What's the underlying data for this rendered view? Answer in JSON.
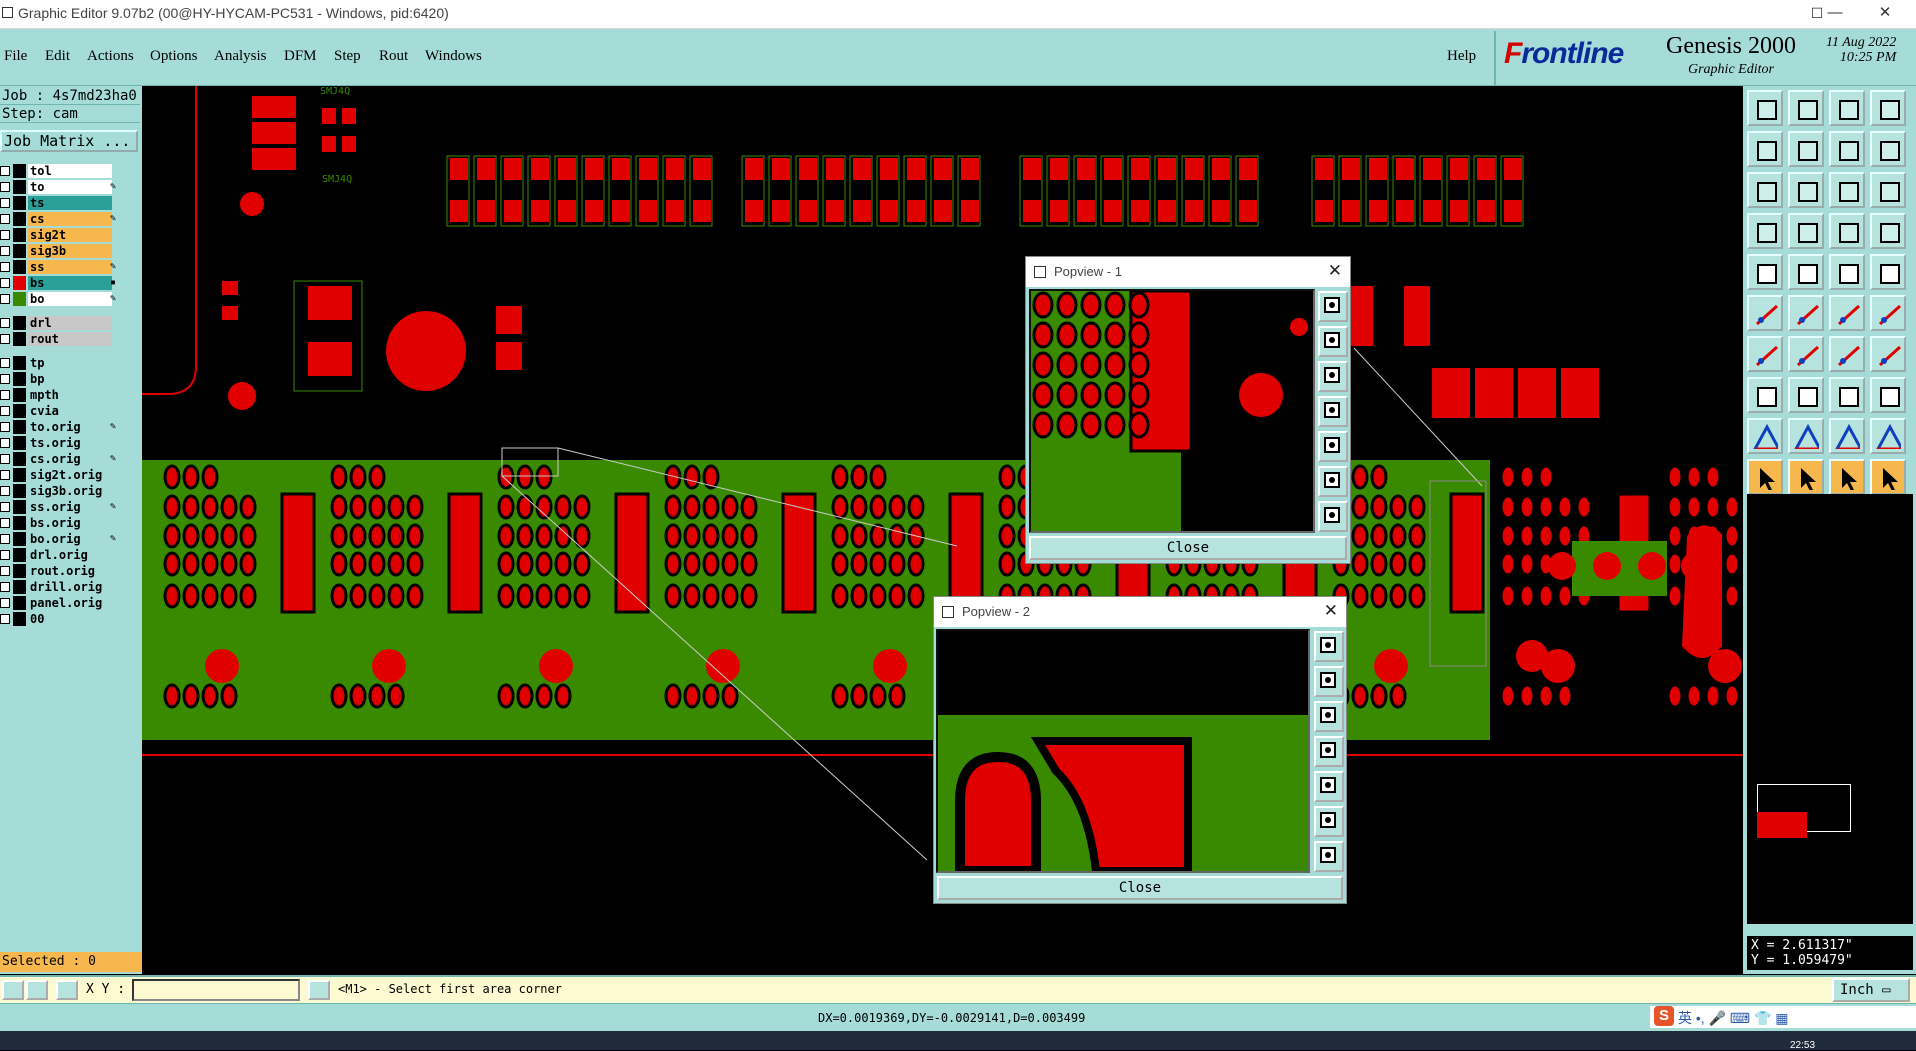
{
  "window": {
    "title": "Graphic Editor 9.07b2 (00@HY-HYCAM-PC531 - Windows, pid:6420)",
    "minimize": "—",
    "maximize": "☐",
    "close": "✕"
  },
  "menu": {
    "items": [
      "File",
      "Edit",
      "Actions",
      "Options",
      "Analysis",
      "DFM",
      "Step",
      "Rout",
      "Windows"
    ],
    "help": "Help"
  },
  "brand": {
    "logo_prefix": "F",
    "logo_rest": "rontline",
    "product": "Genesis 2000",
    "subtitle": "Graphic Editor",
    "date": "11 Aug 2022",
    "time": "10:25 PM"
  },
  "job": {
    "job_line": "Job : 4s7md23ha0",
    "step_line": "Step: cam",
    "matrix_button": "Job Matrix ..."
  },
  "layers": [
    {
      "name": "tol",
      "color": "#ffffff",
      "swatch": "#000000",
      "mark": ""
    },
    {
      "name": "to",
      "color": "#ffffff",
      "swatch": "#000000",
      "mark": "✎"
    },
    {
      "name": "ts",
      "color": "#2aa198",
      "swatch": "#000000",
      "mark": ""
    },
    {
      "name": "cs",
      "color": "#f6b84c",
      "swatch": "#000000",
      "mark": "✎"
    },
    {
      "name": "sig2t",
      "color": "#f6b84c",
      "swatch": "#000000",
      "mark": ""
    },
    {
      "name": "sig3b",
      "color": "#f6b84c",
      "swatch": "#000000",
      "mark": ""
    },
    {
      "name": "ss",
      "color": "#f6b84c",
      "swatch": "#000000",
      "mark": "✎"
    },
    {
      "name": "bs",
      "color": "#2aa198",
      "swatch": "#e00000",
      "mark": "▪"
    },
    {
      "name": "bo",
      "color": "#ffffff",
      "swatch": "#3a8a00",
      "mark": "✎"
    },
    {
      "name": "drl",
      "color": "#c8c8c8",
      "swatch": "#000000",
      "mark": ""
    },
    {
      "name": "rout",
      "color": "#c8c8c8",
      "swatch": "#000000",
      "mark": ""
    },
    {
      "name": "tp",
      "color": "#a6dcd8",
      "swatch": "#000000",
      "mark": ""
    },
    {
      "name": "bp",
      "color": "#a6dcd8",
      "swatch": "#000000",
      "mark": ""
    },
    {
      "name": "mpth",
      "color": "#a6dcd8",
      "swatch": "#000000",
      "mark": ""
    },
    {
      "name": "cvia",
      "color": "#a6dcd8",
      "swatch": "#000000",
      "mark": ""
    },
    {
      "name": "to.orig",
      "color": "#a6dcd8",
      "swatch": "#000000",
      "mark": "✎"
    },
    {
      "name": "ts.orig",
      "color": "#a6dcd8",
      "swatch": "#000000",
      "mark": ""
    },
    {
      "name": "cs.orig",
      "color": "#a6dcd8",
      "swatch": "#000000",
      "mark": "✎"
    },
    {
      "name": "sig2t.orig",
      "color": "#a6dcd8",
      "swatch": "#000000",
      "mark": ""
    },
    {
      "name": "sig3b.orig",
      "color": "#a6dcd8",
      "swatch": "#000000",
      "mark": ""
    },
    {
      "name": "ss.orig",
      "color": "#a6dcd8",
      "swatch": "#000000",
      "mark": "✎"
    },
    {
      "name": "bs.orig",
      "color": "#a6dcd8",
      "swatch": "#000000",
      "mark": ""
    },
    {
      "name": "bo.orig",
      "color": "#a6dcd8",
      "swatch": "#000000",
      "mark": "✎"
    },
    {
      "name": "drl.orig",
      "color": "#a6dcd8",
      "swatch": "#000000",
      "mark": ""
    },
    {
      "name": "rout.orig",
      "color": "#a6dcd8",
      "swatch": "#000000",
      "mark": ""
    },
    {
      "name": "drill.orig",
      "color": "#a6dcd8",
      "swatch": "#000000",
      "mark": ""
    },
    {
      "name": "panel.orig",
      "color": "#a6dcd8",
      "swatch": "#000000",
      "mark": ""
    },
    {
      "name": "00",
      "color": "#a6dcd8",
      "swatch": "#000000",
      "mark": ""
    }
  ],
  "selected": "Selected : 0",
  "canvas_labels": {
    "top_silk": "SMJ4Q",
    "bottom_silk": "SMJ4Q"
  },
  "popviews": [
    {
      "title": "Popview - 1",
      "close_label": "Close"
    },
    {
      "title": "Popview - 2",
      "close_label": "Close"
    }
  ],
  "coordinates": {
    "x": "X = 2.611317\"",
    "y": "Y = 1.059479\""
  },
  "command": {
    "xy_label": "X Y :",
    "xy_value": "",
    "prompt": "<M1> - Select first area corner",
    "units": "Inch ▭"
  },
  "status": "DX=0.0019369,DY=-0.0029141,D=0.003499",
  "tray": {
    "ime_logo": "S",
    "ime_text": "英 •, 🎤 ⌨ 👕 ▦"
  },
  "clock": "22:53",
  "colors": {
    "panel": "#a6dcd8",
    "copper": "#e00000",
    "mask": "#3a8a00",
    "background": "#000000"
  }
}
